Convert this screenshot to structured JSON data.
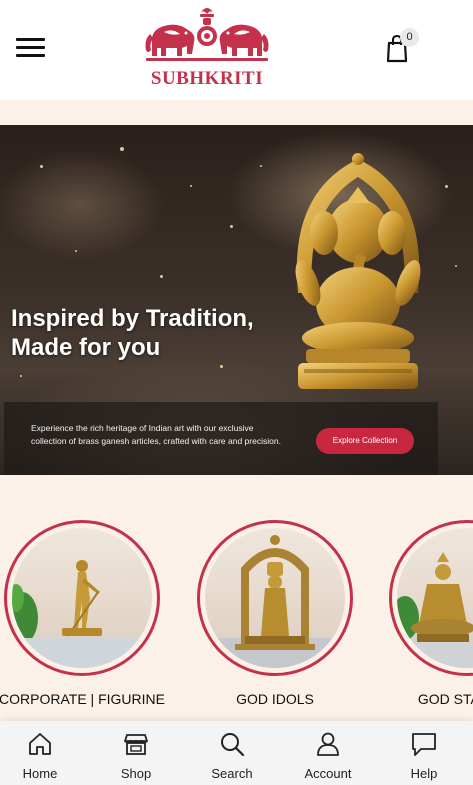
{
  "header": {
    "logo_text": "SUBHKRITI",
    "cart_count": "0",
    "brand_color": "#c4314b"
  },
  "hero": {
    "title_line1": "Inspired by Tradition,",
    "title_line2": "Made for you",
    "description": "Experience the rich heritage of Indian art with our exclusive collection of brass ganesh articles, crafted with care and precision.",
    "cta_label": "Explore Collection"
  },
  "categories": [
    {
      "label": "CORPORATE | FIGURINE"
    },
    {
      "label": "GOD IDOLS"
    },
    {
      "label": "GOD STATUES"
    }
  ],
  "bottom_nav": [
    {
      "label": "Home",
      "icon": "home-icon"
    },
    {
      "label": "Shop",
      "icon": "shop-icon"
    },
    {
      "label": "Search",
      "icon": "search-icon"
    },
    {
      "label": "Account",
      "icon": "account-icon"
    },
    {
      "label": "Help",
      "icon": "help-chat-icon"
    }
  ]
}
